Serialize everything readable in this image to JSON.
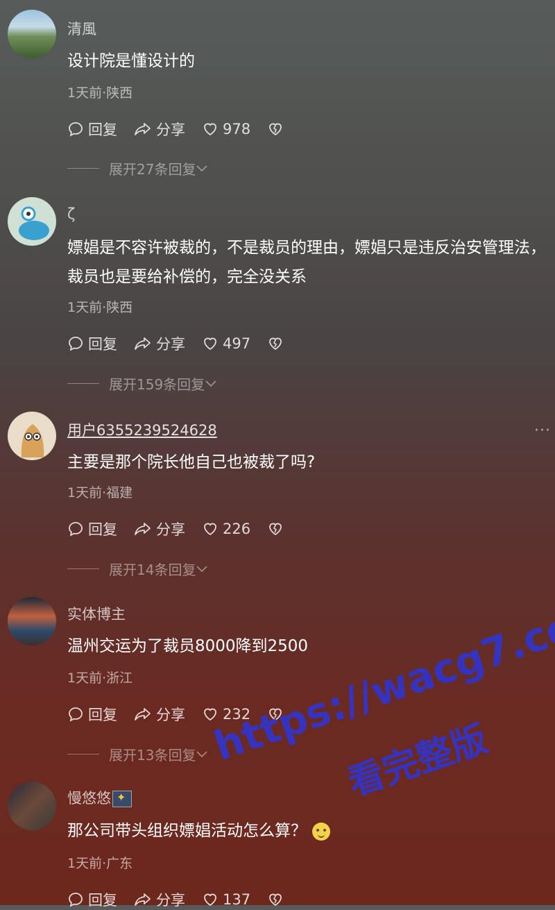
{
  "comments": [
    {
      "username": "清風",
      "text": "设计院是懂设计的",
      "meta": "1天前·陕西",
      "reply": "回复",
      "share": "分享",
      "likes": "978",
      "expand": "展开27条回复"
    },
    {
      "username": "ζ",
      "text": "嫖娼是不容许被裁的，不是裁员的理由，嫖娼只是违反治安管理法，裁员也是要给补偿的，完全没关系",
      "meta": "1天前·陕西",
      "reply": "回复",
      "share": "分享",
      "likes": "497",
      "expand": "展开159条回复"
    },
    {
      "username": "用户6355239524628",
      "text": "主要是那个院长他自己也被裁了吗?",
      "meta": "1天前·福建",
      "reply": "回复",
      "share": "分享",
      "likes": "226",
      "expand": "展开14条回复",
      "more": "···"
    },
    {
      "username": "实体博主",
      "text": "温州交运为了裁员8000降到2500",
      "meta": "1天前·浙江",
      "reply": "回复",
      "share": "分享",
      "likes": "232",
      "expand": "展开13条回复"
    },
    {
      "username": "慢悠悠",
      "text": "那公司带头组织嫖娼活动怎么算？",
      "meta": "1天前·广东",
      "reply": "回复",
      "share": "分享",
      "likes": "137"
    }
  ],
  "watermark": {
    "line1": "https://wacg7.com",
    "line2": "看完整版",
    "color": "#2f35d4"
  },
  "icons": {
    "reply": "comment-bubble-icon",
    "share": "share-arrow-icon",
    "like": "heart-icon",
    "dislike": "broken-heart-icon",
    "expand": "chevron-down-icon"
  }
}
